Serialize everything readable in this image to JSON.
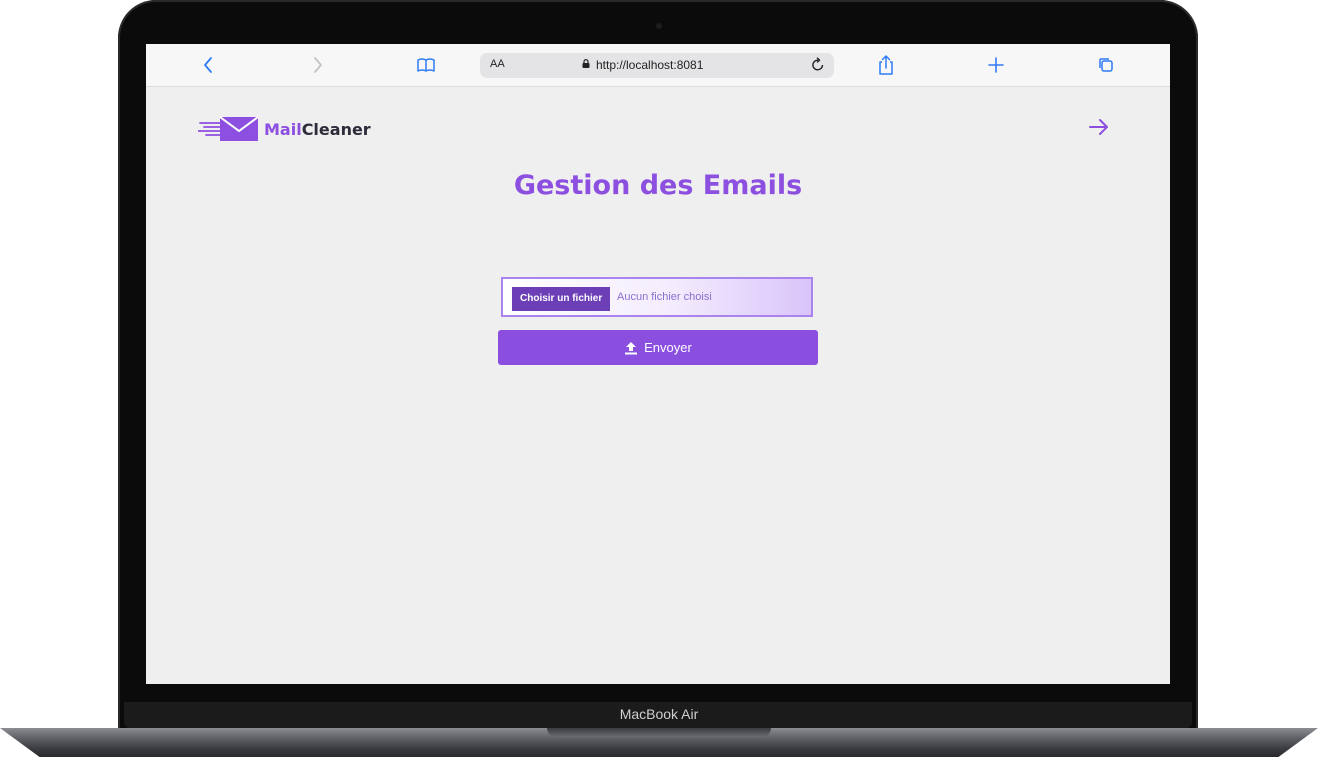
{
  "device": {
    "model_label": "MacBook Air"
  },
  "browser": {
    "url": "http://localhost:8081",
    "aa_label": "AA",
    "icons": {
      "back": "chevron-left-icon",
      "forward": "chevron-right-icon",
      "bookmarks": "book-icon",
      "reload": "reload-icon",
      "share": "share-icon",
      "new_tab": "plus-icon",
      "tabs": "tabs-icon"
    }
  },
  "app": {
    "logo_part1": "Mail",
    "logo_part2": "Cleaner",
    "page_title": "Gestion des Emails",
    "file_input": {
      "choose_label": "Choisir un fichier",
      "status_text": "Aucun fichier choisi"
    },
    "send_label": "Envoyer",
    "colors": {
      "accent": "#8c4fe0",
      "dark_button": "#6c3fb7",
      "page_bg": "#efefef"
    }
  }
}
